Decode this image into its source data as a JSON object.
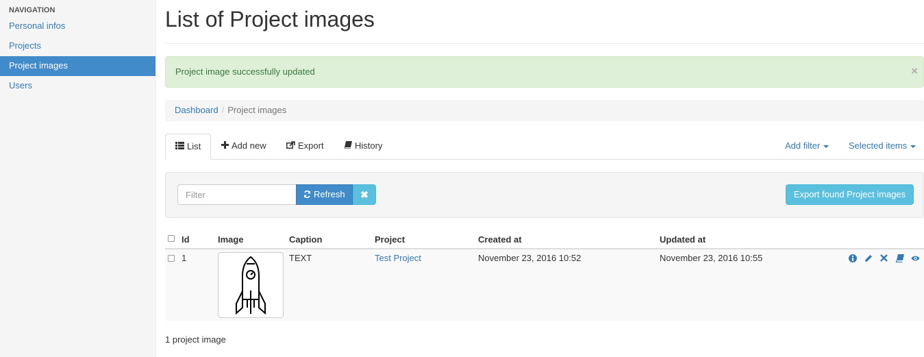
{
  "sidebar": {
    "header": "NAVIGATION",
    "items": [
      {
        "label": "Personal infos",
        "active": false
      },
      {
        "label": "Projects",
        "active": false
      },
      {
        "label": "Project images",
        "active": true
      },
      {
        "label": "Users",
        "active": false
      }
    ]
  },
  "page": {
    "title": "List of Project images"
  },
  "alert": {
    "message": "Project image successfully updated",
    "close": "×"
  },
  "breadcrumb": {
    "root": "Dashboard",
    "separator": "/",
    "current": "Project images"
  },
  "tabs": {
    "list": "List",
    "add_new": "Add new",
    "export": "Export",
    "history": "History",
    "add_filter": "Add filter",
    "selected_items": "Selected items"
  },
  "filter": {
    "placeholder": "Filter",
    "refresh": "Refresh",
    "clear": "✖",
    "export_found": "Export found Project images"
  },
  "table": {
    "columns": [
      "Id",
      "Image",
      "Caption",
      "Project",
      "Created at",
      "Updated at"
    ],
    "rows": [
      {
        "id": "1",
        "image": "rocket-image",
        "caption": "TEXT",
        "project": "Test Project",
        "created_at": "November 23, 2016 10:52",
        "updated_at": "November 23, 2016 10:55"
      }
    ]
  },
  "footer": {
    "count": "1 project image"
  },
  "colors": {
    "primary": "#428bca",
    "info": "#5bc0de",
    "link": "#337ab7",
    "success_bg": "#dff0d8",
    "success_text": "#3c763d"
  }
}
